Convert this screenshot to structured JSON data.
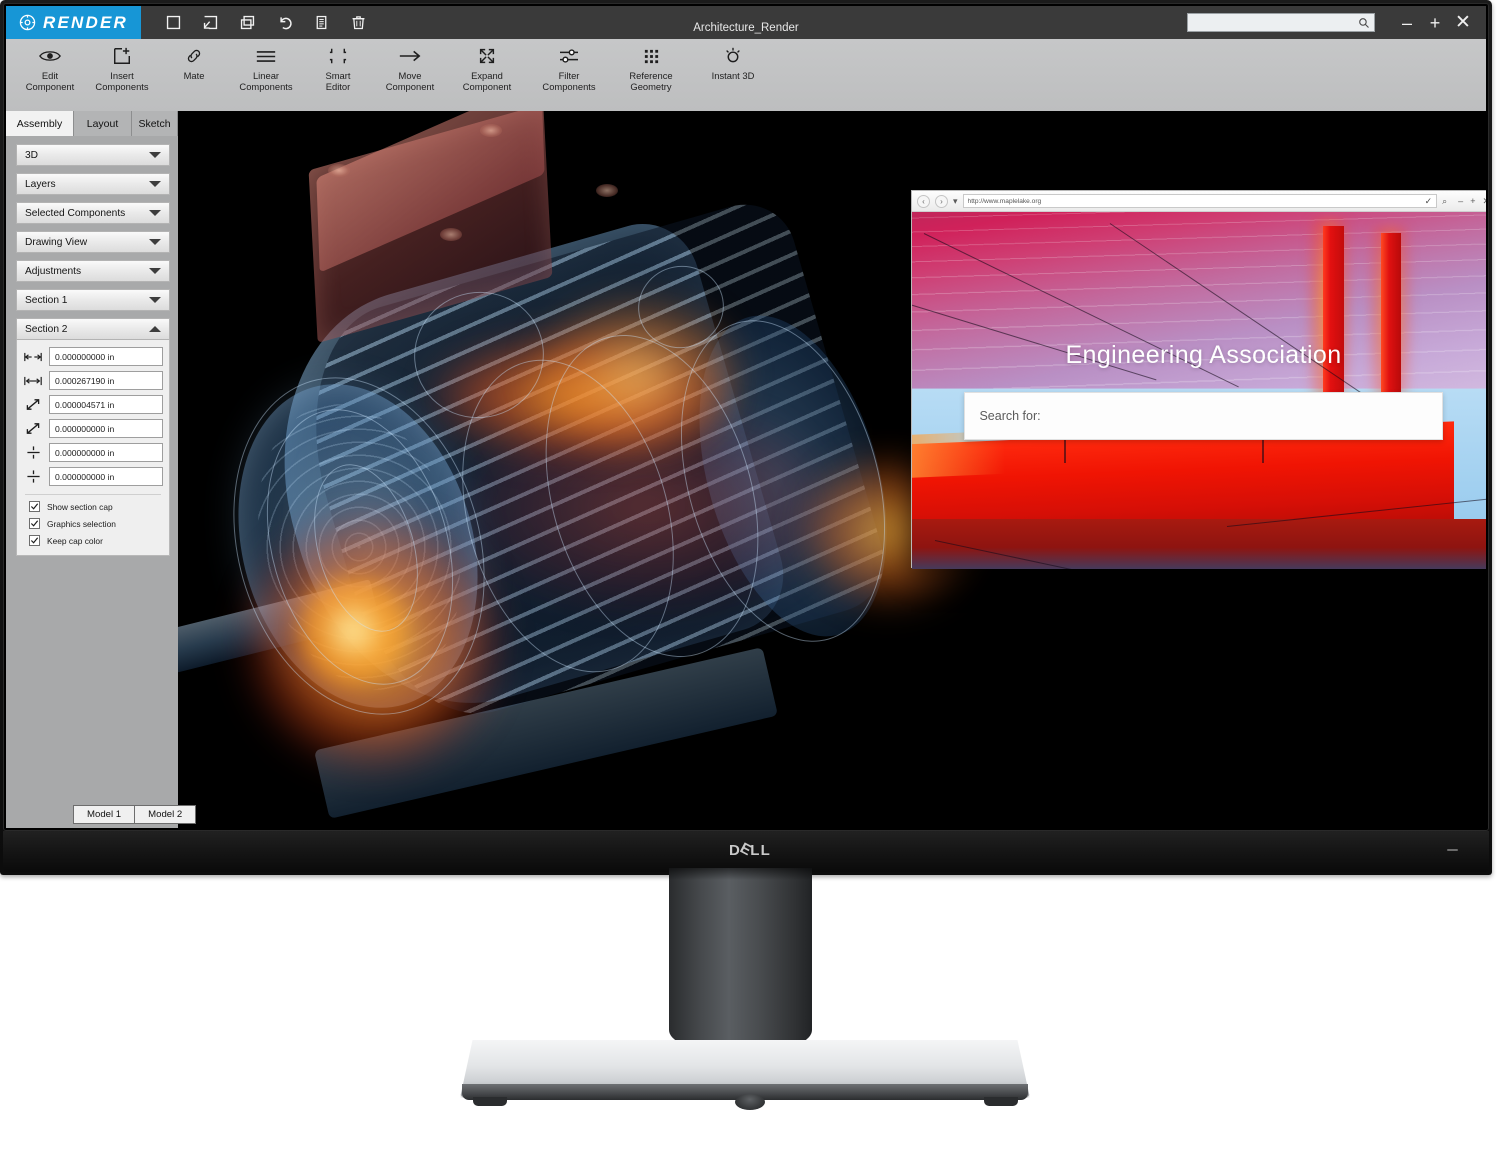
{
  "app": {
    "brand": "RENDER",
    "brand_color": "#1796d6",
    "window_title": "Architecture_Render",
    "titlebar_icons": [
      {
        "name": "new-document-icon",
        "glyph": "square"
      },
      {
        "name": "open-import-icon",
        "glyph": "arrow-into-box"
      },
      {
        "name": "copy-windows-icon",
        "glyph": "stacked-squares"
      },
      {
        "name": "undo-icon",
        "glyph": "undo-arrow"
      },
      {
        "name": "notes-icon",
        "glyph": "lined-page"
      },
      {
        "name": "delete-icon",
        "glyph": "trash-can"
      }
    ],
    "search": {
      "value": "",
      "placeholder": ""
    },
    "window_controls": {
      "minimize": "–",
      "maximize": "+",
      "close": "✕"
    }
  },
  "ribbon": {
    "items": [
      {
        "label": "Edit\nComponent",
        "icon": "eye-icon"
      },
      {
        "label": "Insert\nComponents",
        "icon": "insert-box-plus-icon"
      },
      {
        "label": "Mate",
        "icon": "link-chain-icon"
      },
      {
        "label": "Linear\nComponents",
        "icon": "horizontal-lines-icon"
      },
      {
        "label": "Smart\nEditor",
        "icon": "corner-brackets-icon"
      },
      {
        "label": "Move\nComponent",
        "icon": "right-arrow-icon"
      },
      {
        "label": "Expand\nComponent",
        "icon": "expand-arrows-icon"
      },
      {
        "label": "Filter\nComponents",
        "icon": "sliders-icon"
      },
      {
        "label": "Reference\nGeometry",
        "icon": "dot-grid-icon"
      },
      {
        "label": "Instant 3D",
        "icon": "sun-dial-icon"
      }
    ]
  },
  "sidebar": {
    "tabs": [
      {
        "label": "Assembly",
        "active": true
      },
      {
        "label": "Layout",
        "active": false
      },
      {
        "label": "Sketch",
        "active": false
      }
    ],
    "accordion": [
      {
        "label": "3D",
        "expanded": false
      },
      {
        "label": "Layers",
        "expanded": false
      },
      {
        "label": "Selected Components",
        "expanded": false
      },
      {
        "label": "Drawing View",
        "expanded": false
      },
      {
        "label": "Adjustments",
        "expanded": false
      },
      {
        "label": "Section 1",
        "expanded": false
      },
      {
        "label": "Section 2",
        "expanded": true
      }
    ],
    "section2": {
      "fields": [
        {
          "icon": "offset-width-icon",
          "value": "0.000000000 in"
        },
        {
          "icon": "inner-width-icon",
          "value": "0.000267190 in"
        },
        {
          "icon": "diagonal-out-icon",
          "value": "0.000004571 in"
        },
        {
          "icon": "diagonal-in-icon",
          "value": "0.000000000 in"
        },
        {
          "icon": "divide-icon",
          "value": "0.000000000 in"
        },
        {
          "icon": "divide-icon",
          "value": "0.000000000 in"
        }
      ],
      "checkboxes": [
        {
          "label": "Show section cap",
          "checked": true
        },
        {
          "label": "Graphics selection",
          "checked": true
        },
        {
          "label": "Keep cap color",
          "checked": true
        }
      ]
    }
  },
  "model_tabs": [
    {
      "label": "Model 1",
      "active": true
    },
    {
      "label": "Model 2",
      "active": false
    }
  ],
  "browser": {
    "url": "http://www.maplelake.org",
    "nav": {
      "back": "‹",
      "forward": "›",
      "dropdown": "▾"
    },
    "chrome_buttons": {
      "go_check": "✓",
      "search": "⌕",
      "minimize": "–",
      "maximize": "+",
      "close": "✕"
    },
    "page": {
      "title": "Engineering Association",
      "search_placeholder": "Search for:"
    }
  },
  "monitor": {
    "brand": "DELL",
    "power_led": "on"
  },
  "viewport": {
    "render_subject": "cutaway-electric-motor-thermal-render",
    "background": "#000000"
  }
}
